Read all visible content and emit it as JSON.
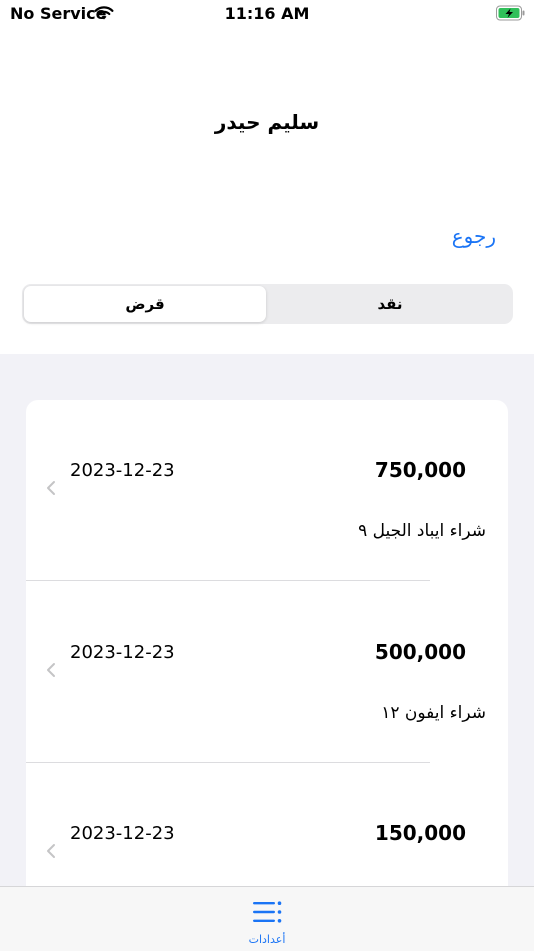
{
  "status_bar": {
    "carrier": "No Service",
    "time": "11:16 AM",
    "battery_icon": "battery-charging-icon",
    "wifi_icon": "wifi-icon"
  },
  "header": {
    "title": "سليم حيدر",
    "back_label": "رجوع"
  },
  "segmented": {
    "options": [
      "قرض",
      "نقد"
    ],
    "selected": "قرض"
  },
  "transactions": [
    {
      "amount": "750,000",
      "date": "2023-12-23",
      "description": "شراء ايباد الجيل ٩"
    },
    {
      "amount": "500,000",
      "date": "2023-12-23",
      "description": "شراء ايفون ١٢"
    },
    {
      "amount": "150,000",
      "date": "2023-12-23",
      "description": ""
    }
  ],
  "tab_bar": {
    "items": [
      {
        "label": "أعدادات",
        "icon": "list-settings-icon"
      }
    ]
  },
  "colors": {
    "accent": "#1a74f5",
    "list_background": "#f2f2f7",
    "segment_background": "#ececee"
  }
}
